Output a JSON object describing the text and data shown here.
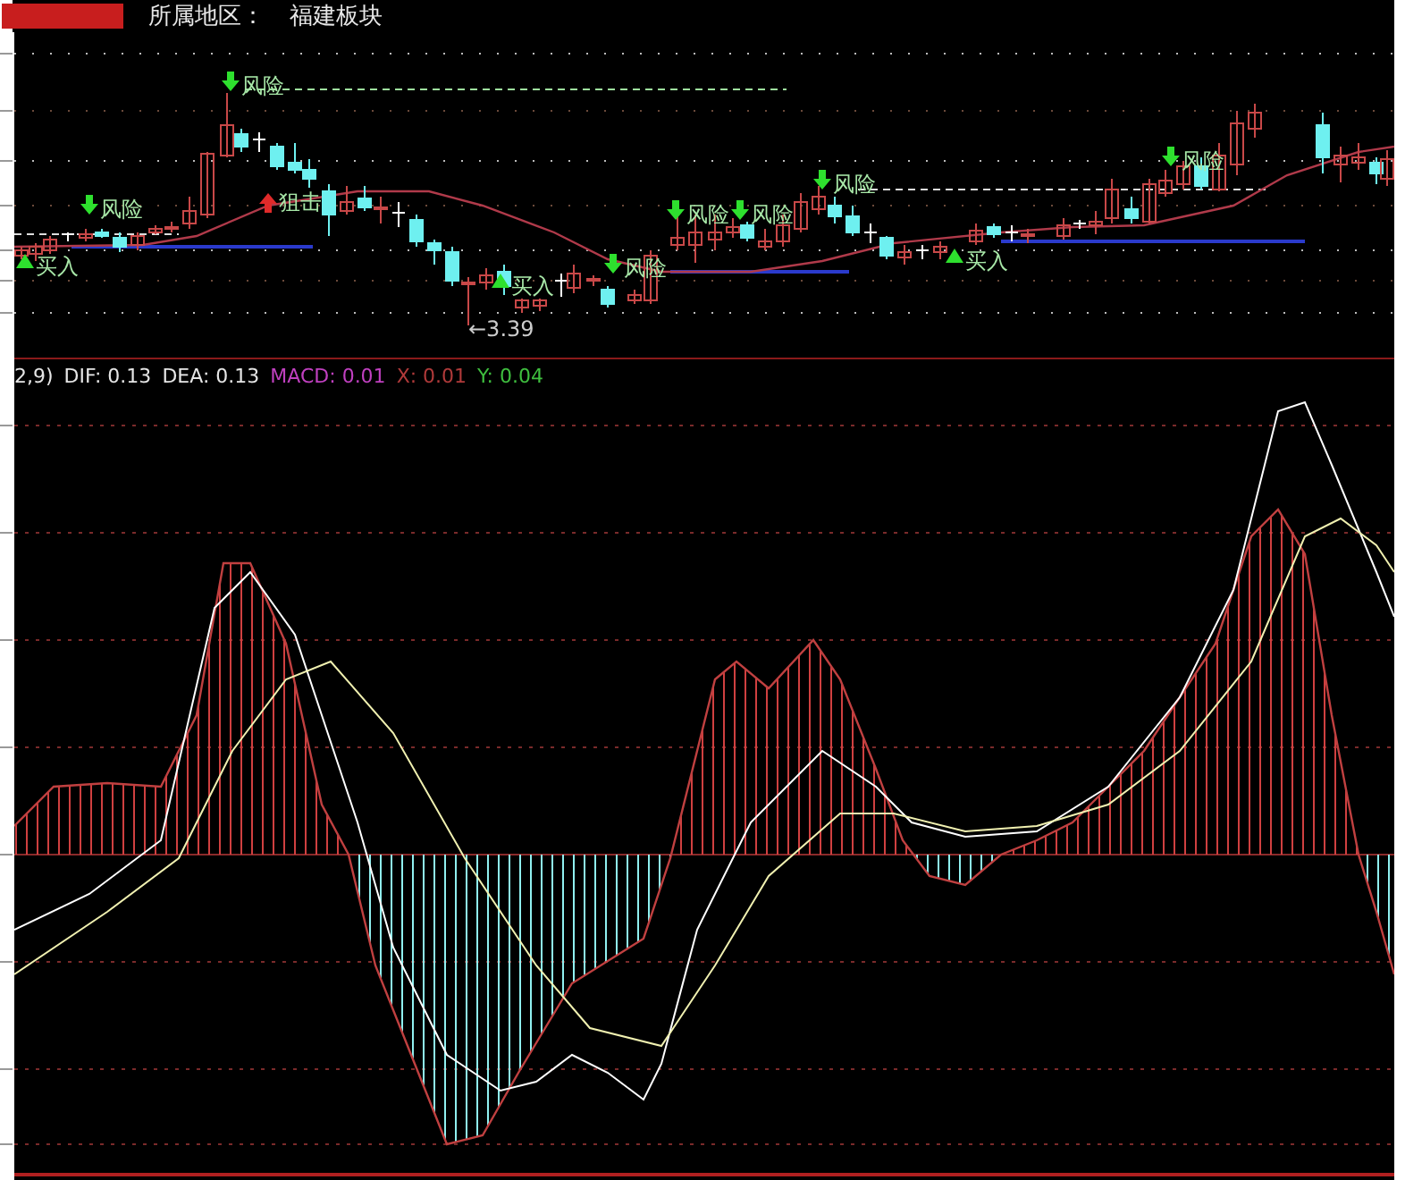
{
  "header": {
    "region_label": "所属地区：",
    "sector": "福建板块"
  },
  "signals": [
    {
      "kind": "buy",
      "text": "买入"
    },
    {
      "kind": "risk",
      "text": "风险"
    },
    {
      "kind": "risk",
      "text": "风险"
    },
    {
      "kind": "snipe",
      "text": "狙击"
    },
    {
      "kind": "buy",
      "text": "买入"
    },
    {
      "kind": "risk",
      "text": "风险"
    },
    {
      "kind": "risk",
      "text": "风险"
    },
    {
      "kind": "risk",
      "text": "风险"
    },
    {
      "kind": "risk",
      "text": "风险"
    },
    {
      "kind": "buy",
      "text": "买入"
    },
    {
      "kind": "risk",
      "text": "风险"
    },
    {
      "kind": "low",
      "text": "←3.39"
    }
  ],
  "indicator": [
    {
      "text": "2,9)",
      "color": "#e6e6e6"
    },
    {
      "text": "DIF: 0.13",
      "color": "#e6e6e6"
    },
    {
      "text": "DEA: 0.13",
      "color": "#e6e6e6"
    },
    {
      "text": "MACD: 0.01",
      "color": "#c040c0"
    },
    {
      "text": "X: 0.01",
      "color": "#b03a3a"
    },
    {
      "text": "Y: 0.04",
      "color": "#3fbf3f"
    }
  ]
}
